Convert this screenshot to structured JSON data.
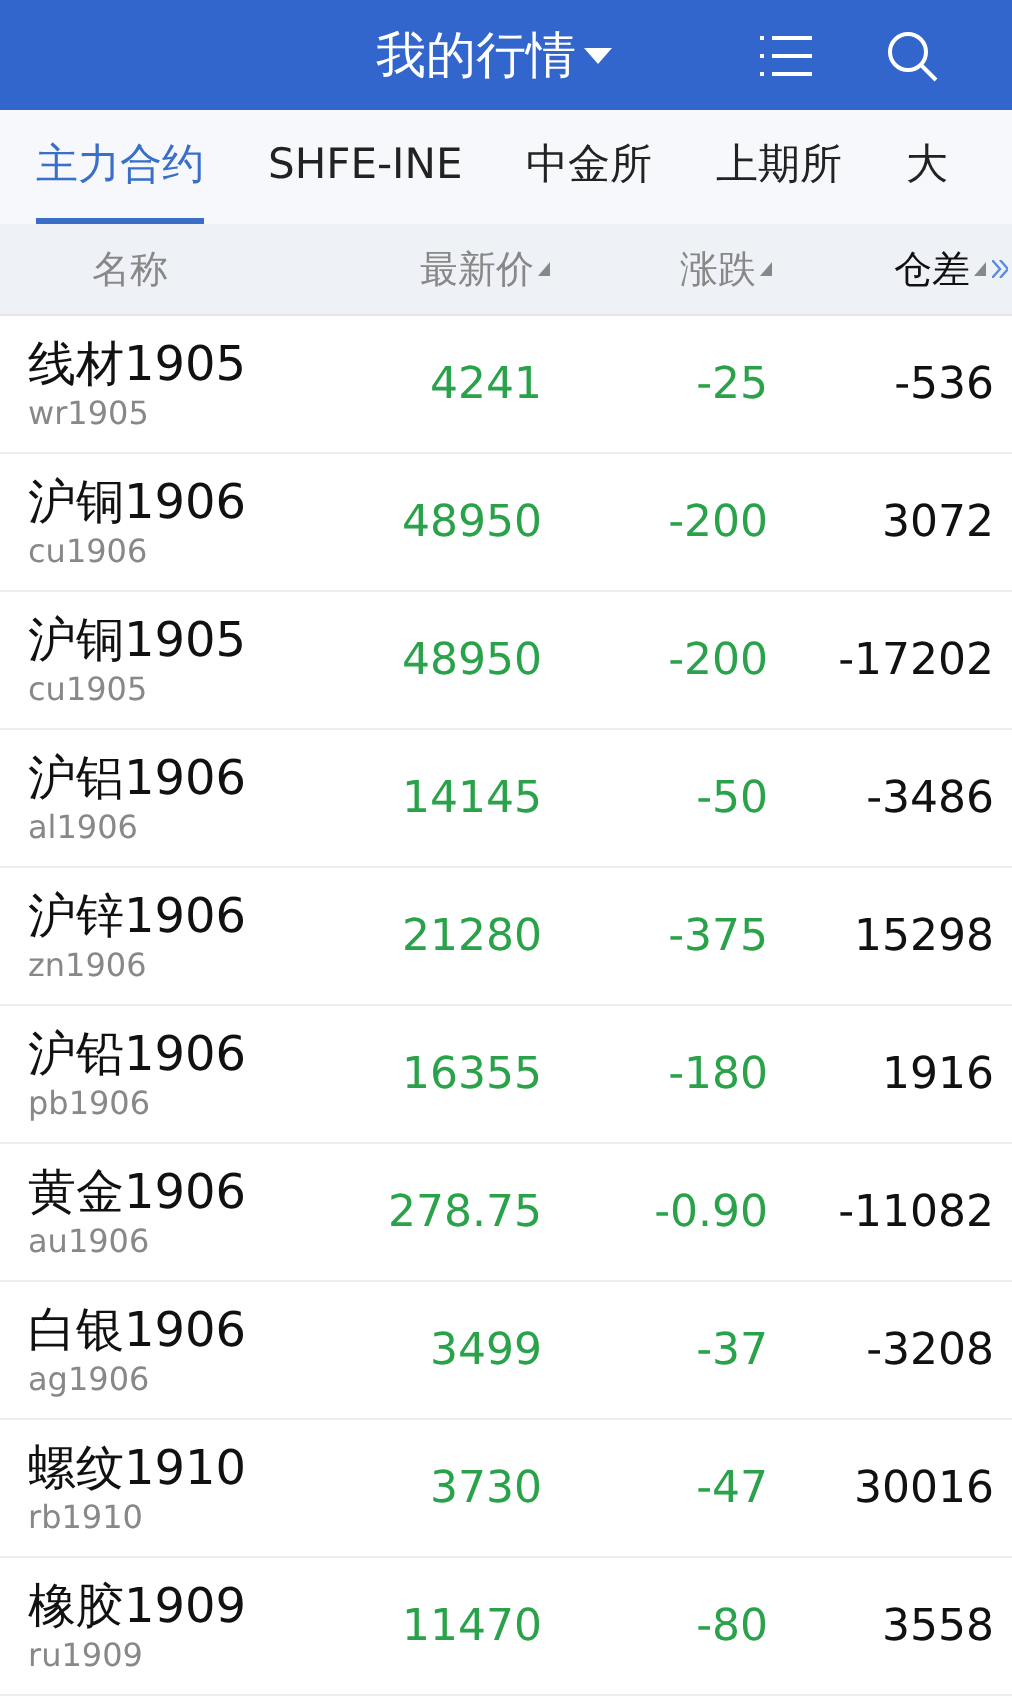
{
  "header": {
    "title": "我的行情"
  },
  "tabs": [
    {
      "label": "主力合约",
      "selected": true
    },
    {
      "label": "SHFE-INE",
      "selected": false
    },
    {
      "label": "中金所",
      "selected": false
    },
    {
      "label": "上期所",
      "selected": false
    },
    {
      "label": "大",
      "selected": false
    }
  ],
  "columns": [
    {
      "label": "名称",
      "sortable": false
    },
    {
      "label": "最新价",
      "sortable": true
    },
    {
      "label": "涨跌",
      "sortable": true
    },
    {
      "label": "仓差",
      "sortable": true
    }
  ],
  "rows": [
    {
      "name": "线材1905",
      "code": "wr1905",
      "price": "4241",
      "change": "-25",
      "oi_change": "-536"
    },
    {
      "name": "沪铜1906",
      "code": "cu1906",
      "price": "48950",
      "change": "-200",
      "oi_change": "3072"
    },
    {
      "name": "沪铜1905",
      "code": "cu1905",
      "price": "48950",
      "change": "-200",
      "oi_change": "-17202"
    },
    {
      "name": "沪铝1906",
      "code": "al1906",
      "price": "14145",
      "change": "-50",
      "oi_change": "-3486"
    },
    {
      "name": "沪锌1906",
      "code": "zn1906",
      "price": "21280",
      "change": "-375",
      "oi_change": "15298"
    },
    {
      "name": "沪铅1906",
      "code": "pb1906",
      "price": "16355",
      "change": "-180",
      "oi_change": "1916"
    },
    {
      "name": "黄金1906",
      "code": "au1906",
      "price": "278.75",
      "change": "-0.90",
      "oi_change": "-11082"
    },
    {
      "name": "白银1906",
      "code": "ag1906",
      "price": "3499",
      "change": "-37",
      "oi_change": "-3208"
    },
    {
      "name": "螺纹1910",
      "code": "rb1910",
      "price": "3730",
      "change": "-47",
      "oi_change": "30016"
    },
    {
      "name": "橡胶1909",
      "code": "ru1909",
      "price": "11470",
      "change": "-80",
      "oi_change": "3558"
    }
  ]
}
